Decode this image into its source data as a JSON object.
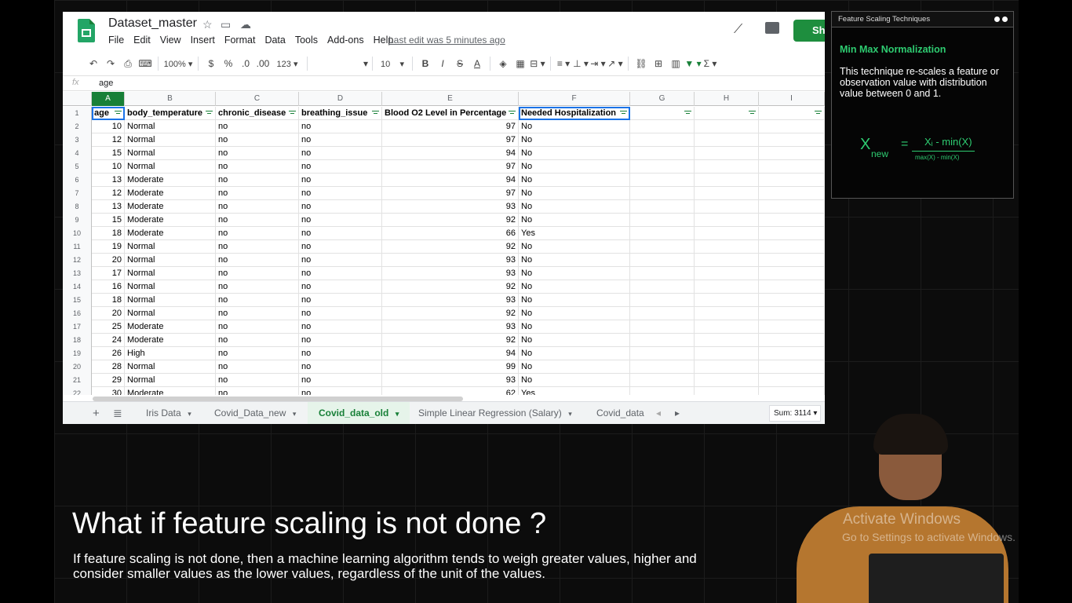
{
  "sheets": {
    "title": "Dataset_master",
    "menu": [
      "File",
      "Edit",
      "View",
      "Insert",
      "Format",
      "Data",
      "Tools",
      "Add-ons",
      "Help"
    ],
    "last_edit": "Last edit was 5 minutes ago",
    "share_label": "Sh",
    "toolbar": {
      "zoom": "100%",
      "currency": "$",
      "percent": "%",
      "dec_less": ".0",
      "dec_more": ".00",
      "more_formats": "123",
      "font_size": "10",
      "bold": "B",
      "italic": "I",
      "strike": "S",
      "text_color": "A"
    },
    "formula_bar": {
      "fx": "fx",
      "value": "age"
    },
    "columns": [
      "A",
      "B",
      "C",
      "D",
      "E",
      "F",
      "G",
      "H",
      "I"
    ],
    "headers": [
      "age",
      "body_temperature",
      "chronic_disease",
      "breathing_issue",
      "Blood O2 Level in Percentage",
      "Needed Hospitalization"
    ],
    "rows": [
      [
        "10",
        "Normal",
        "no",
        "no",
        "97",
        "No"
      ],
      [
        "12",
        "Normal",
        "no",
        "no",
        "97",
        "No"
      ],
      [
        "15",
        "Normal",
        "no",
        "no",
        "94",
        "No"
      ],
      [
        "10",
        "Normal",
        "no",
        "no",
        "97",
        "No"
      ],
      [
        "13",
        "Moderate",
        "no",
        "no",
        "94",
        "No"
      ],
      [
        "12",
        "Moderate",
        "no",
        "no",
        "97",
        "No"
      ],
      [
        "13",
        "Moderate",
        "no",
        "no",
        "93",
        "No"
      ],
      [
        "15",
        "Moderate",
        "no",
        "no",
        "92",
        "No"
      ],
      [
        "18",
        "Moderate",
        "no",
        "no",
        "66",
        "Yes"
      ],
      [
        "19",
        "Normal",
        "no",
        "no",
        "92",
        "No"
      ],
      [
        "20",
        "Normal",
        "no",
        "no",
        "93",
        "No"
      ],
      [
        "17",
        "Normal",
        "no",
        "no",
        "93",
        "No"
      ],
      [
        "16",
        "Normal",
        "no",
        "no",
        "92",
        "No"
      ],
      [
        "18",
        "Normal",
        "no",
        "no",
        "93",
        "No"
      ],
      [
        "20",
        "Normal",
        "no",
        "no",
        "92",
        "No"
      ],
      [
        "25",
        "Moderate",
        "no",
        "no",
        "93",
        "No"
      ],
      [
        "24",
        "Moderate",
        "no",
        "no",
        "92",
        "No"
      ],
      [
        "26",
        "High",
        "no",
        "no",
        "94",
        "No"
      ],
      [
        "28",
        "Normal",
        "no",
        "no",
        "99",
        "No"
      ],
      [
        "29",
        "Normal",
        "no",
        "no",
        "93",
        "No"
      ],
      [
        "30",
        "Moderate",
        "no",
        "no",
        "62",
        "Yes"
      ]
    ],
    "tabs": [
      "Iris Data",
      "Covid_Data_new",
      "Covid_data_old",
      "Simple Linear Regression (Salary)",
      "Covid_data"
    ],
    "active_tab": "Covid_data_old",
    "sum": "Sum: 3114",
    "accent_color": "#188038"
  },
  "card": {
    "title": "Feature Scaling Techniques",
    "heading": "Min Max Normalization",
    "body": "This technique re-scales a feature or observation value with distribution value between 0 and 1.",
    "formula": {
      "lhs": "X",
      "lhs_sub": "new",
      "eq": "=",
      "numerator": "Xᵢ - min(X)",
      "denominator": "max(X) - min(X)"
    }
  },
  "caption": {
    "question": "What if feature scaling is not done ?",
    "explanation": "If feature scaling is not done, then a machine learning algorithm tends to weigh greater values, higher and consider smaller values as the lower values, regardless of the unit of the values."
  },
  "watermark": {
    "line1": "Activate Windows",
    "line2": "Go to Settings to activate Windows."
  }
}
